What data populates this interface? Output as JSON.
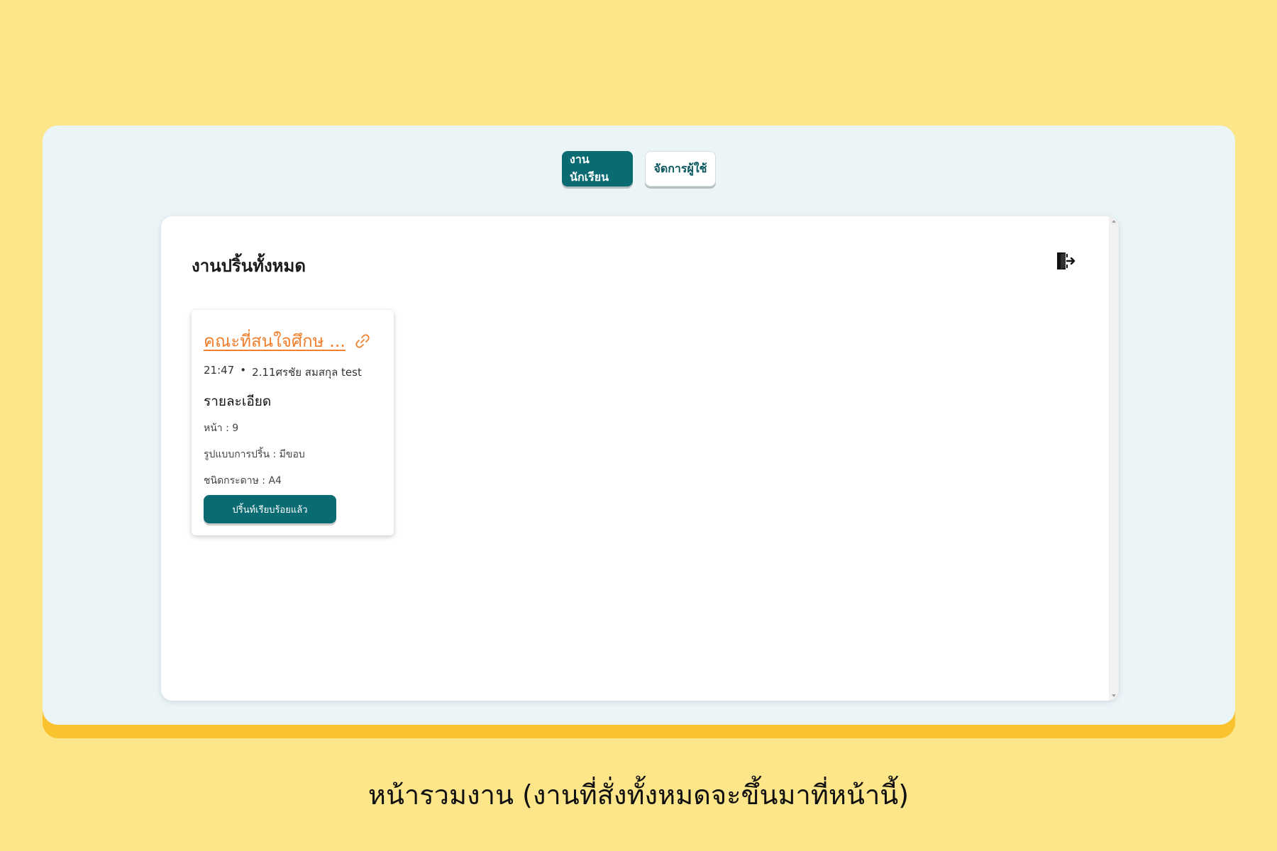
{
  "nav": {
    "student_work": "งานนักเรียน",
    "manage_users": "จัดการผู้ใช้"
  },
  "panel": {
    "title": "งานปริ้นทั้งหมด"
  },
  "card": {
    "title": "คณะที่สนใจศึกษ ...",
    "time": "21:47",
    "separator": "•",
    "owner": "2.11ศรชัย สมสกุล test",
    "details_heading": "รายละเอียด",
    "pages": "หน้า : 9",
    "print_format": "รูปแบบการปริ้น : มีขอบ",
    "paper_type": "ชนิดกระดาษ : A4",
    "status_button": "ปริ้นท์เรียบร้อยแล้ว"
  },
  "caption": "หน้ารวมงาน (งานที่สั่งทั้งหมดจะขึ้นมาที่หน้านี้)",
  "colors": {
    "background": "#fde58a",
    "accent_teal": "#0b6b73",
    "link_orange": "#f07f2e",
    "frame": "#ebf5f8",
    "frame_shadow": "#f9c22e"
  },
  "icons": [
    "logout-icon",
    "link-icon"
  ]
}
